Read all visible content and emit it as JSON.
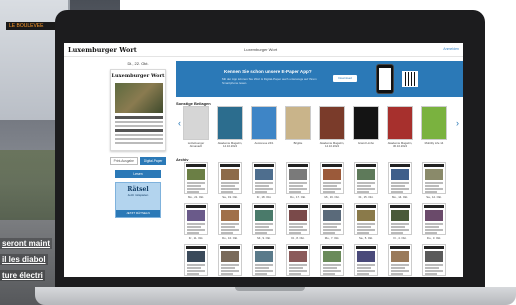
{
  "background": {
    "bus_sign": "LE BOULEVEE",
    "overlay_lines": [
      "seront maint",
      "il les diabol",
      "ture électri"
    ]
  },
  "site": {
    "logo": "Luxemburger Wort",
    "title": "Luxemburger Wort",
    "top_link": "Anmelden"
  },
  "left": {
    "date": "Di., 22. Okt.",
    "cover_logo": "Luxemburger Wort",
    "edition_tabs": [
      "Print-Ausgabe",
      "Digital-Paper"
    ],
    "read_button": "Lesen",
    "puzzle_title": "Rätsel",
    "puzzle_subtitle": "Jetzt mitspielen",
    "puzzle_footer": "JETZT RÄTSELN"
  },
  "banner": {
    "headline": "Kennen Sie schon unsere E-Paper App?",
    "subtext": "Mit der App können Sie Wort & Digital-Paper auch unterwegs auf Ihrem Smartphone lesen.",
    "button": "Download",
    "color": "#2b79b7"
  },
  "sections": {
    "supplements": "Sonstige Beilagen",
    "archive": "Archiv"
  },
  "supplements": [
    {
      "label": "Lëtzebuerger Almanach",
      "color": "#d6d6d6"
    },
    {
      "label": "Akademie Magazin, 14.10.2024",
      "color": "#2c6d8e"
    },
    {
      "label": "Autorevue 24/1",
      "color": "#3e85c6"
    },
    {
      "label": "Brigitte",
      "color": "#c9b48a"
    },
    {
      "label": "Akademie Magazin, 14.10.2024",
      "color": "#7a3b2a"
    },
    {
      "label": "Grand Limbo",
      "color": "#141414"
    },
    {
      "label": "Akademie Magazin, 30.10.2024",
      "color": "#a7302d"
    },
    {
      "label": "Mobility Life 14",
      "color": "#7ab23f"
    }
  ],
  "archive": [
    {
      "label": "Mo., 21. Okt.",
      "pic": "#6b7f45"
    },
    {
      "label": "Sa., 19. Okt.",
      "pic": "#8d6b4a"
    },
    {
      "label": "Fr., 18. Okt.",
      "pic": "#4e6e8e"
    },
    {
      "label": "Do., 17. Okt.",
      "pic": "#7a7a7a"
    },
    {
      "label": "Mi., 16. Okt.",
      "pic": "#9b5a3a"
    },
    {
      "label": "Di., 15. Okt.",
      "pic": "#5e7a5a"
    },
    {
      "label": "Mo., 14. Okt.",
      "pic": "#3f5f8a"
    },
    {
      "label": "Sa., 12. Okt.",
      "pic": "#8a8a6a"
    },
    {
      "label": "Fr., 11. Okt.",
      "pic": "#6a5a8a"
    },
    {
      "label": "Do., 10. Okt.",
      "pic": "#a0704a"
    },
    {
      "label": "Mi., 9. Okt.",
      "pic": "#4a7a6a"
    },
    {
      "label": "Di., 8. Okt.",
      "pic": "#7a4a4a"
    },
    {
      "label": "Mo., 7. Okt.",
      "pic": "#5a6a7a"
    },
    {
      "label": "Sa., 5. Okt.",
      "pic": "#8a7a4a"
    },
    {
      "label": "Fr., 4. Okt.",
      "pic": "#4a5a3a"
    },
    {
      "label": "Do., 3. Okt.",
      "pic": "#6a4a6a"
    },
    {
      "label": "Mi., 2. Okt.",
      "pic": "#3a4a5a"
    },
    {
      "label": "Di., 1. Okt.",
      "pic": "#7a6a5a"
    },
    {
      "label": "Mo., 30. Sep.",
      "pic": "#5a7a8a"
    },
    {
      "label": "Sa., 28. Sep.",
      "pic": "#8a5a5a"
    },
    {
      "label": "Fr., 27. Sep.",
      "pic": "#6a8a5a"
    },
    {
      "label": "Do., 26. Sep.",
      "pic": "#4a4a7a"
    },
    {
      "label": "Mi., 25. Sep.",
      "pic": "#9a7a5a"
    },
    {
      "label": "Di., 24. Sep.",
      "pic": "#5a5a5a"
    }
  ]
}
